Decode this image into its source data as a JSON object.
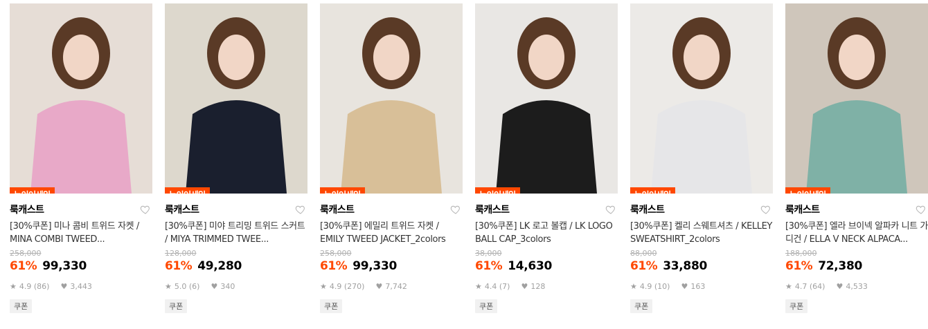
{
  "products": [
    {
      "tag": "뉴이어세일",
      "brand": "룩캐스트",
      "title": "[30%쿠폰] 미나 콤비 트위드 자켓 / MINA COMBI TWEED...",
      "original_price": "258,000",
      "discount": "61%",
      "price": "99,330",
      "rating": "4.9 (86)",
      "likes": "3,443",
      "badge": "쿠폰",
      "image_bg": "#e6ddd6",
      "image_accent": "#e8a9c8"
    },
    {
      "tag": "뉴이어세일",
      "brand": "룩캐스트",
      "title": "[30%쿠폰] 미야 트리밍 트위드 스커트 / MIYA TRIMMED TWEE...",
      "original_price": "128,000",
      "discount": "61%",
      "price": "49,280",
      "rating": "5.0 (6)",
      "likes": "340",
      "badge": "쿠폰",
      "image_bg": "#ddd8cd",
      "image_accent": "#1a1f2e"
    },
    {
      "tag": "뉴이어세일",
      "brand": "룩캐스트",
      "title": "[30%쿠폰] 에밀리 트위드 자켓 / EMILY TWEED JACKET_2colors",
      "original_price": "258,000",
      "discount": "61%",
      "price": "99,330",
      "rating": "4.9 (270)",
      "likes": "7,742",
      "badge": "쿠폰",
      "image_bg": "#e8e4de",
      "image_accent": "#d8bf98"
    },
    {
      "tag": "뉴이어세일",
      "brand": "룩캐스트",
      "title": "[30%쿠폰] LK 로고 볼캡 / LK LOGO BALL CAP_3colors",
      "original_price": "38,000",
      "discount": "61%",
      "price": "14,630",
      "rating": "4.4 (7)",
      "likes": "128",
      "badge": "쿠폰",
      "image_bg": "#e9e7e4",
      "image_accent": "#1c1c1c"
    },
    {
      "tag": "뉴이어세일",
      "brand": "룩캐스트",
      "title": "[30%쿠폰] 켈리 스웨트셔츠 / KELLEY SWEATSHIRT_2colors",
      "original_price": "88,000",
      "discount": "61%",
      "price": "33,880",
      "rating": "4.9 (10)",
      "likes": "163",
      "badge": "쿠폰",
      "image_bg": "#eceae7",
      "image_accent": "#e6e6e8"
    },
    {
      "tag": "뉴이어세일",
      "brand": "룩캐스트",
      "title": "[30%쿠폰] 엘라 브이넥 알파카 니트 가디건 / ELLA V NECK ALPACA...",
      "original_price": "188,000",
      "discount": "61%",
      "price": "72,380",
      "rating": "4.7 (64)",
      "likes": "4,533",
      "badge": "쿠폰",
      "image_bg": "#cfc6bb",
      "image_accent": "#7fb1a6"
    }
  ],
  "icons": {
    "wishlist": "heart-outline-icon",
    "rating": "star-icon",
    "likes": "heart-filled-icon"
  },
  "colors": {
    "accent": "#ff4800",
    "muted": "#a0a0a0"
  }
}
